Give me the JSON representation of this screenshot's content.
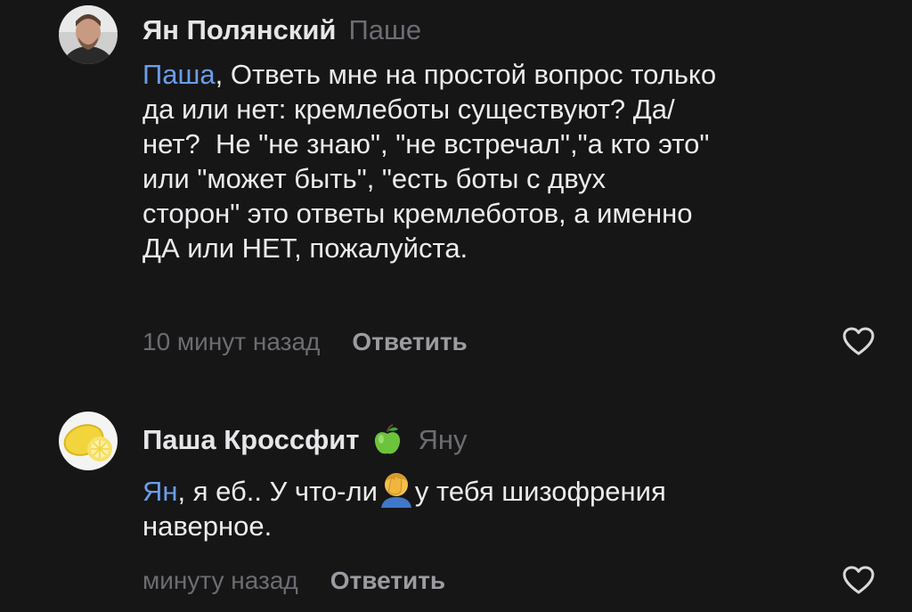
{
  "comments": [
    {
      "author": "Ян Полянский",
      "reply_to": "Паше",
      "mention": "Паша",
      "text": ", Ответь мне на простой вопрос только\nда или нет: кремлеботы существуют? Да/\nнет?  Не \"не знаю\", \"не встречал\",\"а кто это\"\nили \"может быть\", \"есть боты с двух\nсторон\" это ответы кремлеботов, а именно\nДА или НЕТ, пожалуйста.",
      "time": "10 минут назад",
      "reply_label": "Ответить",
      "avatar_icon": "user-photo-avatar",
      "like_icon": "heart-outline-icon"
    },
    {
      "author": "Паша Кроссфит",
      "badge_icon": "green-apple-icon",
      "reply_to": "Яну",
      "mention": "Ян",
      "text_before": ", я еб.. У что-ли",
      "inline_emoji": "face-palm-emoji",
      "text_after": "у тебя шизофрения\nнаверное.",
      "time": "минуту назад",
      "reply_label": "Ответить",
      "avatar_icon": "lemon-avatar",
      "like_icon": "heart-outline-icon"
    }
  ],
  "colors": {
    "background": "#161617",
    "mention": "#6b9de8",
    "muted": "#6c6c72",
    "text": "#ececee"
  }
}
